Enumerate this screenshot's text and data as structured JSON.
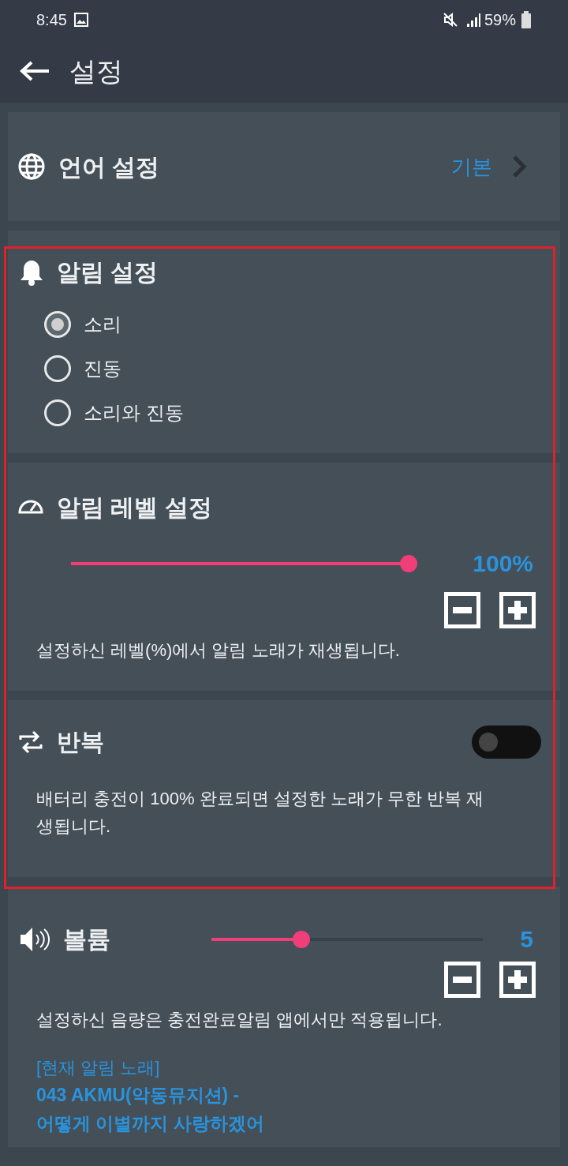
{
  "status_bar": {
    "time": "8:45",
    "battery": "59%"
  },
  "app_bar": {
    "title": "설정"
  },
  "language": {
    "label": "언어 설정",
    "value": "기본"
  },
  "alarm": {
    "title": "알림 설정",
    "options": [
      {
        "label": "소리",
        "selected": true
      },
      {
        "label": "진동",
        "selected": false
      },
      {
        "label": "소리와 진동",
        "selected": false
      }
    ]
  },
  "alarm_level": {
    "title": "알림 레벨 설정",
    "level": 1,
    "reading": "100%",
    "description": "설정하신 레벨(%)에서 알림 노래가 재생됩니다."
  },
  "repeat": {
    "title": "반복",
    "on": false,
    "description": "배터리 충전이 100% 완료되면 설정한 노래가 무한 반복 재생됩니다."
  },
  "volume": {
    "title": "볼륨",
    "level": 0.33,
    "reading": "5",
    "description": "설정하신 음량은 충전완료알림 앱에서만 적용됩니다.",
    "song_heading": "[현재 알림 노래]",
    "song_lines": [
      "043 AKMU(악동뮤지션) -",
      "어떻게 이별까지 사랑하겠어"
    ]
  }
}
